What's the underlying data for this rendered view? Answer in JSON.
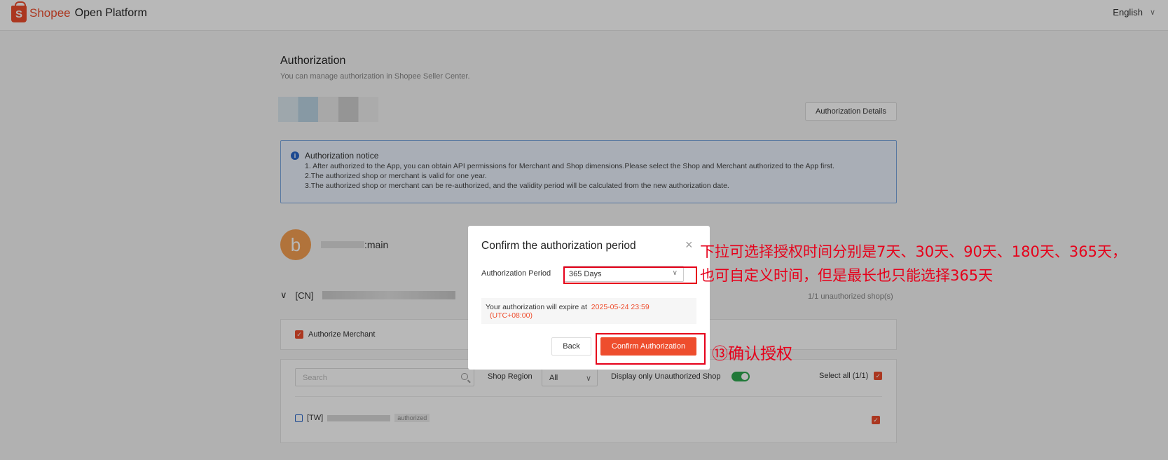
{
  "header": {
    "logo_shopee": "Shopee",
    "logo_platform": "Open Platform",
    "language": "English"
  },
  "page": {
    "title": "Authorization",
    "subtitle": "You can manage authorization in Shopee Seller Center.",
    "auth_details_label": "Authorization Details"
  },
  "notice": {
    "title": "Authorization notice",
    "lines": [
      "1. After authorized to the App, you can obtain API permissions for Merchant and Shop dimensions.Please select the Shop and Merchant authorized to the App first.",
      "2.The authorized shop or merchant is valid for one year.",
      "3.The authorized shop or merchant can be re-authorized, and the validity period will be calculated from the new authorization date."
    ]
  },
  "account": {
    "avatar_letter": "b",
    "name_suffix": ":main"
  },
  "merchant": {
    "prefix": "[CN]",
    "unauth_count": "1/1 unauthorized shop(s)",
    "authorize_label": "Authorize Merchant"
  },
  "filters": {
    "search_placeholder": "Search",
    "region_label": "Shop Region",
    "region_value": "All",
    "unauth_only_label": "Display only Unauthorized Shop",
    "select_all_label": "Select all (1/1)"
  },
  "shop": {
    "prefix": "[TW]",
    "badge": "authorized"
  },
  "modal": {
    "title": "Confirm the authorization period",
    "period_label": "Authorization Period",
    "period_value": "365 Days",
    "expire_text": "Your authorization will expire at",
    "expire_date": "2025-05-24 23:59",
    "expire_tz": "(UTC+08:00)",
    "back_label": "Back",
    "confirm_label": "Confirm Authorization"
  },
  "annotations": {
    "period_line1": "下拉可选择授权时间分别是7天、30天、90天、180天、365天，",
    "period_line2": "也可自定义时间，但是最长也只能选择365天",
    "confirm_note": "⑬确认授权",
    "color": "#e6001a"
  }
}
